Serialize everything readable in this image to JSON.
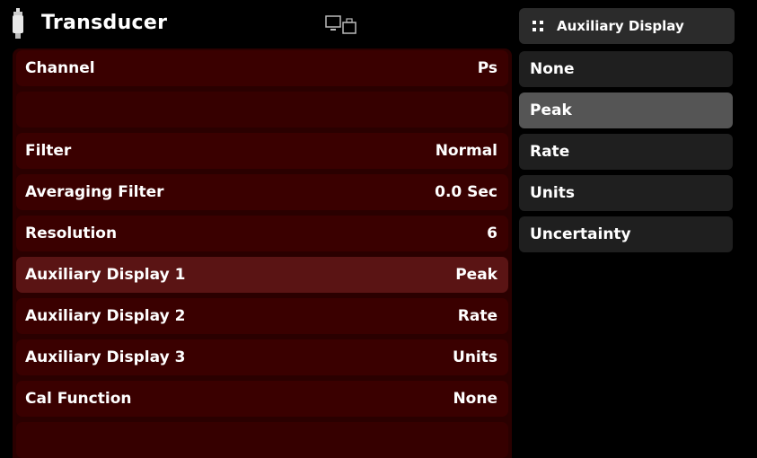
{
  "header": {
    "title": "Transducer",
    "icon": "transducer-icon",
    "remote_icon": "remote-monitor-icon"
  },
  "settings": [
    {
      "label": "Channel",
      "value": "Ps"
    },
    {
      "label": "",
      "value": ""
    },
    {
      "label": "Filter",
      "value": "Normal"
    },
    {
      "label": "Averaging Filter",
      "value": "0.0 Sec"
    },
    {
      "label": "Resolution",
      "value": "6"
    },
    {
      "label": "Auxiliary Display 1",
      "value": "Peak"
    },
    {
      "label": "Auxiliary Display 2",
      "value": "Rate"
    },
    {
      "label": "Auxiliary Display 3",
      "value": "Units"
    },
    {
      "label": "Cal Function",
      "value": "None"
    },
    {
      "label": "",
      "value": ""
    }
  ],
  "selected_setting": "Auxiliary Display 1",
  "options_panel": {
    "title": "Auxiliary Display",
    "icon": "grid-menu-icon",
    "options": [
      "None",
      "Peak",
      "Rate",
      "Units",
      "Uncertainty"
    ],
    "selected": "Peak"
  },
  "colors": {
    "background": "#000000",
    "panel": "#2a0000",
    "row": "#3a0000",
    "row_selected": "#5a1414",
    "option": "#1f1f1f",
    "option_selected": "#555555"
  }
}
